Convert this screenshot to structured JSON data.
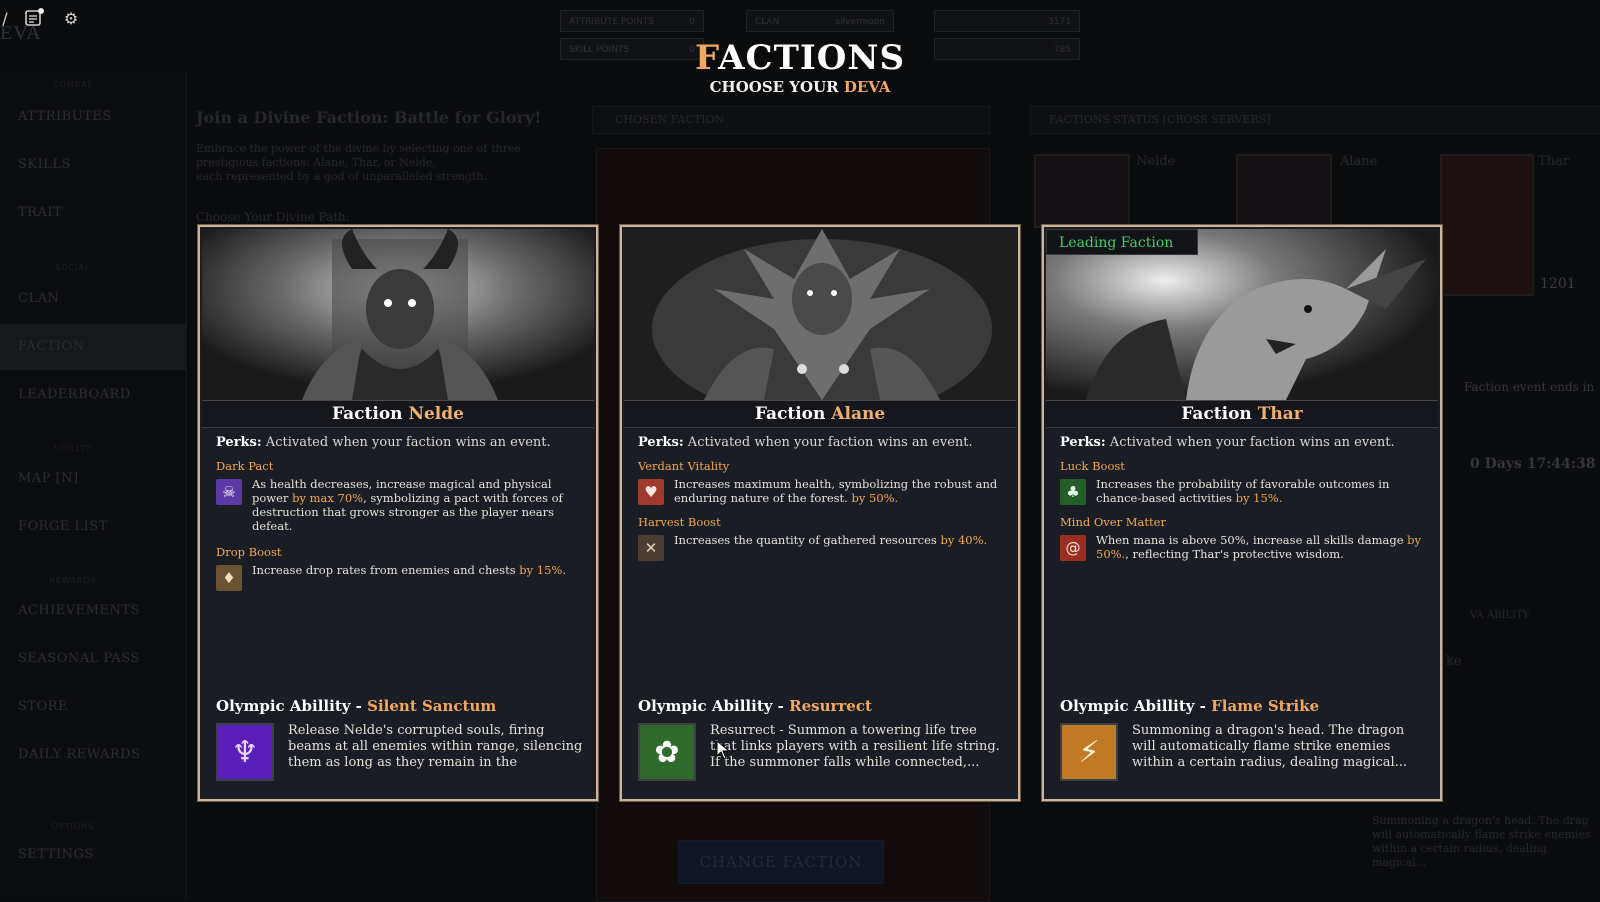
{
  "top_bar": {
    "icons": [
      "menu-frag-icon",
      "notes-icon",
      "gear-icon"
    ],
    "logo_fragment": "EVA",
    "stats": [
      {
        "label": "ATTRIBUTE POINTS",
        "value": "0"
      },
      {
        "label": "SKILL POINTS",
        "value": "0"
      },
      {
        "label": "CLAN",
        "value": "silvermoon"
      },
      {
        "label": "",
        "value": "3171"
      },
      {
        "label": "",
        "value": "785"
      }
    ]
  },
  "header": {
    "title_first": "F",
    "title_rest": "ACTIONS",
    "subtitle_prefix": "CHOOSE YOUR ",
    "subtitle_highlight": "DEVA"
  },
  "sidebar": {
    "groups": [
      "COMBAT",
      "SOCIAL",
      "UTILITY",
      "REWARDS",
      "OPTIONS"
    ],
    "items": [
      {
        "label": "ATTRIBUTES"
      },
      {
        "label": "SKILLS"
      },
      {
        "label": "TRAIT"
      },
      {
        "label": "CLAN"
      },
      {
        "label": "FACTION"
      },
      {
        "label": "LEADERBOARD"
      },
      {
        "label": "MAP [N]"
      },
      {
        "label": "FORGE LIST"
      },
      {
        "label": "ACHIEVEMENTS"
      },
      {
        "label": "SEASONAL PASS"
      },
      {
        "label": "STORE"
      },
      {
        "label": "DAILY REWARDS"
      },
      {
        "label": "SETTINGS"
      }
    ]
  },
  "background_page": {
    "join_heading": "Join a Divine Faction: Battle for Glory!",
    "intro_lines": [
      "Embrace the power of the divine by selecting one of three",
      "prestigious factions: Alane, Thar, or Nelde,",
      "each represented by a god of unparalleled strength."
    ],
    "choose_path": "Choose Your Divine Path:",
    "chosen_faction_label": "CHOSEN FACTION",
    "faction_status_label": "FACTIONS STATUS [CROSS SERVERS]",
    "status_names": [
      "Nelde",
      "Alane",
      "Thar"
    ],
    "status_value": "1201",
    "event_ends": "Faction event ends in",
    "countdown": "0 Days 17:44:38",
    "ability_label": "VA ABILITY",
    "ability_frag": "ke",
    "bottom_desc": [
      "Summoning a dragon's head. The drag",
      "will automatically flame strike enemies",
      "within a certain radius, dealing magical..."
    ],
    "change_faction": "CHANGE FACTION"
  },
  "cards": [
    {
      "prefix": "Faction ",
      "name": "Nelde",
      "art_icon": "horned-demon-king-portrait",
      "leading": false,
      "perks_label": "Perks:",
      "perks_text": " Activated when your faction wins an event.",
      "perks": [
        {
          "name": "Dark Pact",
          "icon": "demon-mask-icon",
          "icon_color": "#7a4bd1",
          "desc_before": "As health decreases, increase magical and physical power ",
          "desc_highlight": "by max 70%",
          "desc_after": ", symbolizing a pact with forces of destruction that grows stronger as the player nears defeat."
        },
        {
          "name": "Drop Boost",
          "icon": "loot-sack-icon",
          "icon_color": "#8a6a3a",
          "desc_before": "Increase drop rates from enemies and chests ",
          "desc_highlight": "by 15%",
          "desc_after": "."
        }
      ],
      "ability_prefix": "Olympic Abillity - ",
      "ability_name": "Silent Sanctum",
      "ability_icon": "corrupted-soul-icon",
      "ability_color": "#6a2bd0",
      "ability_desc": "Release Nelde's corrupted souls, firing beams at all enemies within range, silencing them as long as they remain in the"
    },
    {
      "prefix": "Faction ",
      "name": "Alane",
      "art_icon": "treant-guardian-portrait",
      "leading": false,
      "perks_label": "Perks:",
      "perks_text": " Activated when your faction wins an event.",
      "perks": [
        {
          "name": "Verdant Vitality",
          "icon": "heart-icon",
          "icon_color": "#b8473a",
          "desc_before": "Increases maximum health, symbolizing the robust and enduring nature of the forest. ",
          "desc_highlight": "by 50%.",
          "desc_after": ""
        },
        {
          "name": "Harvest Boost",
          "icon": "crossed-tools-icon",
          "icon_color": "#5a4a3a",
          "desc_before": "Increases the quantity of gathered resources ",
          "desc_highlight": "by 40%.",
          "desc_after": ""
        }
      ],
      "ability_prefix": "Olympic Abillity - ",
      "ability_name": "Resurrect",
      "ability_icon": "life-tree-icon",
      "ability_color": "#3f8a3a",
      "ability_desc": "Resurrect - Summon a towering life tree that links players with a resilient life string. If the summoner falls while connected,..."
    },
    {
      "prefix": "Faction ",
      "name": "Thar",
      "art_icon": "dragon-head-portrait",
      "leading": true,
      "leading_label": "Leading Faction",
      "perks_label": "Perks:",
      "perks_text": " Activated when your faction wins an event.",
      "perks": [
        {
          "name": "Luck Boost",
          "icon": "clover-icon",
          "icon_color": "#2e7d32",
          "desc_before": "Increases the probability of favorable outcomes in chance-based activities ",
          "desc_highlight": "by 15%.",
          "desc_after": ""
        },
        {
          "name": "Mind Over Matter",
          "icon": "swirl-icon",
          "icon_color": "#b33a2a",
          "desc_before": "When mana is above 50%, increase all skills damage ",
          "desc_highlight": "by 50%.",
          "desc_after": ", reflecting Thar's protective wisdom."
        }
      ],
      "ability_prefix": "Olympic Abillity - ",
      "ability_name": "Flame Strike",
      "ability_icon": "claw-slash-icon",
      "ability_color": "#d08a30",
      "ability_desc": "Summoning a dragon's head. The dragon will automatically flame strike enemies within a certain radius, dealing magical..."
    }
  ]
}
